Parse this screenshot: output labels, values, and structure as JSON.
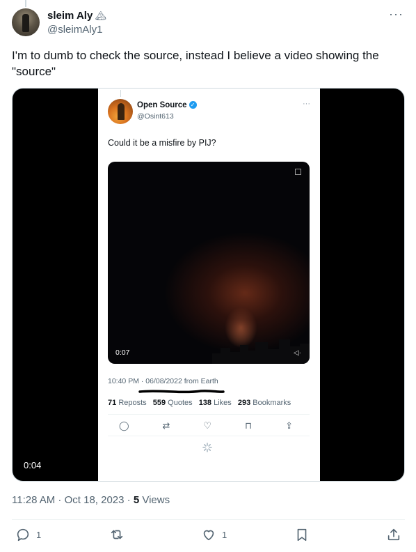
{
  "author": {
    "name": "sleim Aly",
    "emoji": "🏔",
    "handle": "@sleimAly1"
  },
  "tweet": {
    "text": "I'm to dumb to check the source, instead I believe a video showing the \"source\""
  },
  "media": {
    "duration": "0:04",
    "embedded": {
      "author_name": "Open Source",
      "author_handle": "@Osint613",
      "more": "···",
      "text": "Could it be a misfire by PIJ?",
      "video_time": "0:07",
      "meta": "10:40 PM · 06/08/2022 from Earth",
      "stats": [
        {
          "value": "71",
          "label": "Reposts"
        },
        {
          "value": "559",
          "label": "Quotes"
        },
        {
          "value": "138",
          "label": "Likes"
        },
        {
          "value": "293",
          "label": "Bookmarks"
        }
      ]
    }
  },
  "timestamp": {
    "time": "11:28 AM · Oct 18, 2023 · ",
    "views_count": "5",
    "views_label": " Views"
  },
  "actions": {
    "reply_count": "1",
    "like_count": "1"
  },
  "colors": {
    "accent": "#1d9bf0",
    "text_secondary": "#536471"
  }
}
